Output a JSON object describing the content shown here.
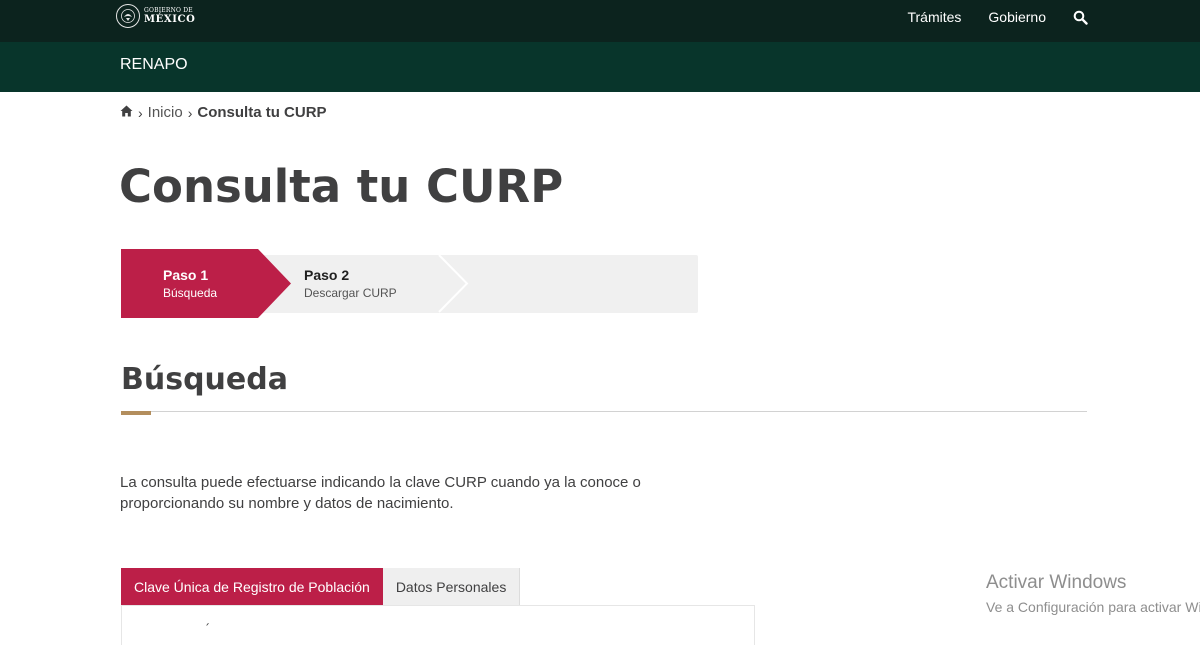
{
  "header": {
    "logo_line1": "GOBIERNO DE",
    "logo_line2": "MÉXICO",
    "nav": [
      {
        "label": "Trámites"
      },
      {
        "label": "Gobierno"
      }
    ],
    "search_icon": "search-icon"
  },
  "subheader": {
    "title": "RENAPO"
  },
  "breadcrumb": {
    "home_icon": "home-icon",
    "items": [
      {
        "label": "Inicio"
      },
      {
        "label": "Consulta tu CURP"
      }
    ]
  },
  "page": {
    "title": "Consulta tu CURP"
  },
  "stepper": {
    "steps": [
      {
        "label": "Paso 1",
        "sub": "Búsqueda",
        "active": true
      },
      {
        "label": "Paso 2",
        "sub": "Descargar CURP",
        "active": false
      }
    ],
    "colors": {
      "active": "#bc1f48",
      "inactive": "#f0f0f0"
    }
  },
  "section": {
    "title": "Búsqueda",
    "accent_color": "#b38e5d"
  },
  "description": {
    "line1": "La consulta puede efectuarse indicando la clave CURP cuando ya la conoce o",
    "line2": "proporcionando su nombre y datos de nacimiento."
  },
  "tabs": [
    {
      "label": "Clave Única de Registro de Población",
      "active": true
    },
    {
      "label": "Datos Personales",
      "active": false
    }
  ],
  "watermark": {
    "title": "Activar Windows",
    "subtitle": "Ve a Configuración para activar Windows."
  },
  "colors": {
    "topbar": "#0c231e",
    "subbar": "#08352b",
    "accent": "#bc1f48"
  }
}
